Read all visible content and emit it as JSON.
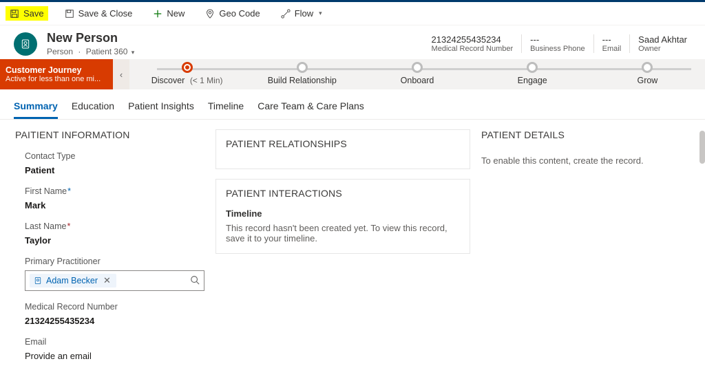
{
  "commands": {
    "save": "Save",
    "save_close": "Save & Close",
    "new": "New",
    "geo": "Geo Code",
    "flow": "Flow"
  },
  "header": {
    "title": "New Person",
    "entity": "Person",
    "form": "Patient 360",
    "meta": {
      "mrn_value": "21324255435234",
      "mrn_label": "Medical Record Number",
      "phone_value": "---",
      "phone_label": "Business Phone",
      "email_value": "---",
      "email_label": "Email",
      "owner_value": "Saad Akhtar",
      "owner_label": "Owner"
    }
  },
  "journey": {
    "title": "Customer Journey",
    "sub": "Active for less than one mi...",
    "stages": {
      "s1_label": "Discover",
      "s1_time": "(< 1 Min)",
      "s2_label": "Build Relationship",
      "s3_label": "Onboard",
      "s4_label": "Engage",
      "s5_label": "Grow"
    }
  },
  "tabs": {
    "t1": "Summary",
    "t2": "Education",
    "t3": "Patient Insights",
    "t4": "Timeline",
    "t5": "Care Team & Care Plans"
  },
  "col1": {
    "section": "PAITIENT INFORMATION",
    "contact_type_label": "Contact Type",
    "contact_type_value": "Patient",
    "first_name_label": "First Name",
    "first_name_value": "Mark",
    "last_name_label": "Last Name",
    "last_name_value": "Taylor",
    "practitioner_label": "Primary Practitioner",
    "practitioner_value": "Adam Becker",
    "mrn_label": "Medical Record Number",
    "mrn_value": "21324255435234",
    "email_label": "Email",
    "email_placeholder": "Provide an email"
  },
  "col2": {
    "relationships_title": "PATIENT RELATIONSHIPS",
    "interactions_title": "PATIENT INTERACTIONS",
    "timeline_head": "Timeline",
    "timeline_msg": "This record hasn't been created yet.  To view this record, save it to your timeline."
  },
  "col3": {
    "details_title": "PATIENT DETAILS",
    "details_msg": "To enable this content, create the record."
  }
}
